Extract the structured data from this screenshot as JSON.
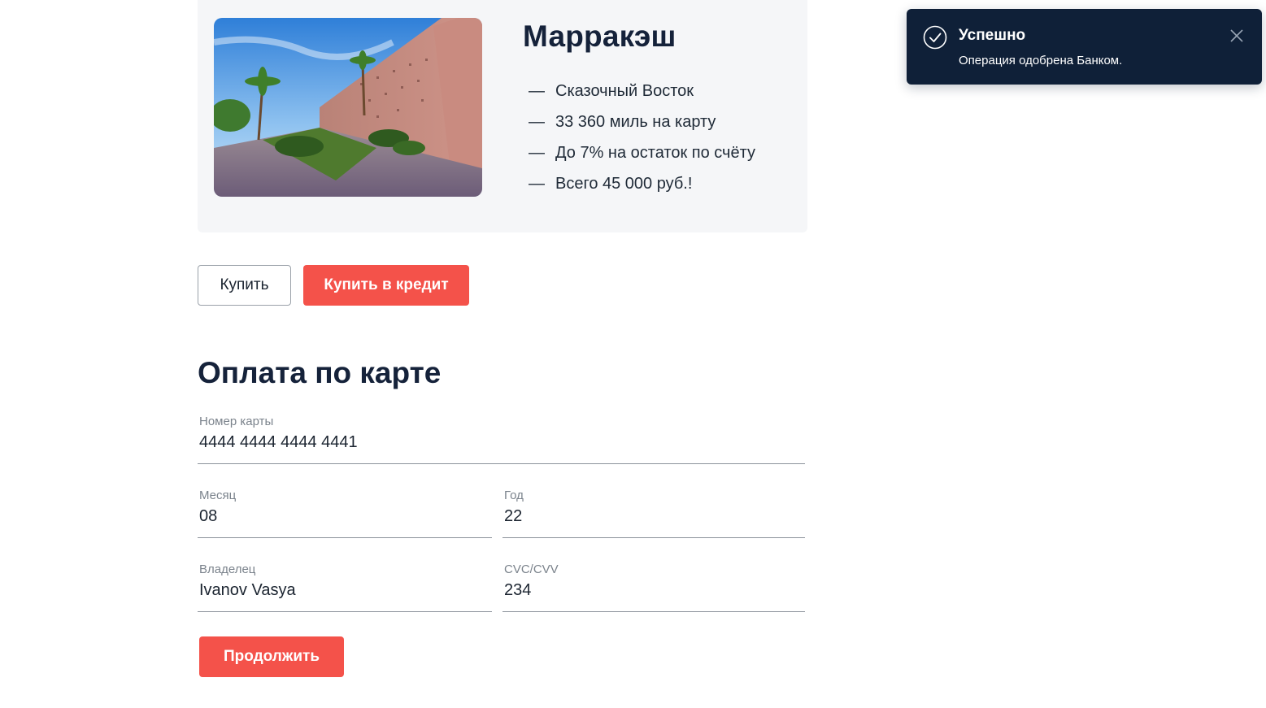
{
  "tour": {
    "title": "Марракэш",
    "image_alt": "Стены Марракэша с пальмами",
    "features": [
      {
        "dash": "—",
        "text": "Сказочный Восток"
      },
      {
        "dash": "—",
        "text": "33 360 миль на карту"
      },
      {
        "dash": "—",
        "text": "До 7% на остаток по счёту"
      },
      {
        "dash": "—",
        "text": "Всего 45 000 руб.!"
      }
    ]
  },
  "actions": {
    "buy_label": "Купить",
    "buy_credit_label": "Купить в кредит"
  },
  "payment": {
    "title": "Оплата по карте",
    "card_number": {
      "label": "Номер карты",
      "value": "4444 4444 4444 4441"
    },
    "month": {
      "label": "Месяц",
      "value": "08"
    },
    "year": {
      "label": "Год",
      "value": "22"
    },
    "owner": {
      "label": "Владелец",
      "value": "Ivanov Vasya"
    },
    "cvc": {
      "label": "CVC/CVV",
      "value": "234"
    },
    "continue_label": "Продолжить"
  },
  "notification": {
    "status": "success",
    "icon": "check-circle-icon",
    "title": "Успешно",
    "message": "Операция одобрена Банком."
  },
  "colors": {
    "accent": "#f4524a",
    "toast_background": "#0f2038",
    "card_background": "#f5f6f8",
    "heading": "#15223a"
  }
}
